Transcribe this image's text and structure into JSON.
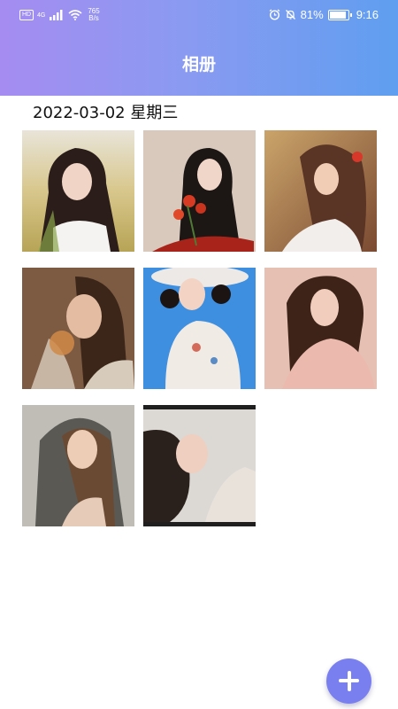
{
  "status_bar": {
    "sim_label": "HD",
    "network_label": "4G",
    "net_speed_value": "765",
    "net_speed_unit": "B/s",
    "battery": "81%",
    "time": "9:16",
    "battery_level": 0.81
  },
  "app_bar": {
    "title": "相册"
  },
  "album": {
    "date_header": "2022-03-02 星期三",
    "photos": [
      {
        "name": "photo-1"
      },
      {
        "name": "photo-2"
      },
      {
        "name": "photo-3"
      },
      {
        "name": "photo-4"
      },
      {
        "name": "photo-5"
      },
      {
        "name": "photo-6"
      },
      {
        "name": "photo-7"
      },
      {
        "name": "photo-8"
      }
    ]
  },
  "fab": {
    "icon": "plus-icon",
    "color": "#7a7ff0"
  },
  "colors": {
    "appbar_gradient_start": "#a58cf0",
    "appbar_gradient_end": "#5f9ef0"
  }
}
